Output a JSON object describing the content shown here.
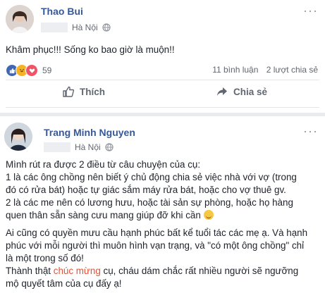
{
  "post1": {
    "author": "Thao Bui",
    "location": "Hà Nội",
    "more": "···",
    "text": "Khâm phục!!! Sống ko bao giờ là muộn!!",
    "reaction_count": "59",
    "comments": "11 bình luận",
    "shares": "2 lượt chia sẻ",
    "like_label": "Thích",
    "share_label": "Chia sẻ"
  },
  "post2": {
    "author": "Trang Minh Nguyen",
    "location": "Hà Nội",
    "more": "···",
    "para1_lines": [
      "Mình rút ra được 2 điều từ câu chuyện của cụ:",
      "1 là các ông chồng nên biết ý chủ động chia sẻ việc nhà với vợ (trong",
      "đó có rửa bát) hoặc tự giác sắm máy rửa bát, hoặc cho vợ thuê gv.",
      "2 là các me nên có lương hưu, hoặc tài sản sự phòng, hoặc họ hàng"
    ],
    "para1_last": "quen thân sẵn sàng cưu mang giúp đỡ khi cần",
    "para2_lines": [
      "Ai cũng có quyền mưu cầu hạnh phúc bất kể tuổi tác các mẹ ạ. Và hạnh",
      "phúc với mỗi người thì muôn hình vạn trạng, và \"có một ông chồng\" chỉ",
      "là một trong số đó!"
    ],
    "para3_start": "Thành thật ",
    "para3_highlight": "chúc mừng",
    "para3_end": " cụ, cháu dám chắc rất nhiều người sẽ ngưỡng",
    "para3_last": "mộ quyết tâm của cụ đấy ạ!"
  },
  "colors": {
    "name": "#365899",
    "highlight": "#e0533c",
    "like": "#4267b2"
  }
}
